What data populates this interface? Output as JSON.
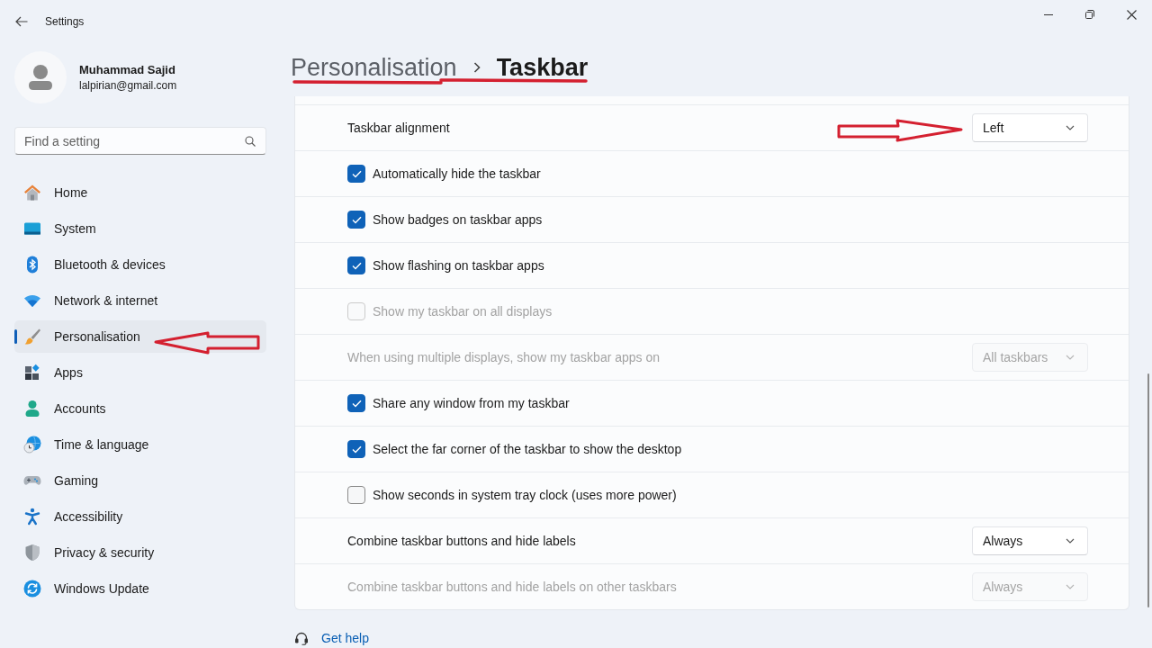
{
  "window": {
    "title": "Settings"
  },
  "user": {
    "name": "Muhammad Sajid",
    "email": "lalpirian@gmail.com"
  },
  "search": {
    "placeholder": "Find a setting"
  },
  "sidebar": {
    "items": [
      {
        "label": "Home",
        "selected": false
      },
      {
        "label": "System",
        "selected": false
      },
      {
        "label": "Bluetooth & devices",
        "selected": false
      },
      {
        "label": "Network & internet",
        "selected": false
      },
      {
        "label": "Personalisation",
        "selected": true
      },
      {
        "label": "Apps",
        "selected": false
      },
      {
        "label": "Accounts",
        "selected": false
      },
      {
        "label": "Time & language",
        "selected": false
      },
      {
        "label": "Gaming",
        "selected": false
      },
      {
        "label": "Accessibility",
        "selected": false
      },
      {
        "label": "Privacy & security",
        "selected": false
      },
      {
        "label": "Windows Update",
        "selected": false
      }
    ]
  },
  "breadcrumb": [
    "Personalisation",
    "Taskbar"
  ],
  "settings": [
    {
      "kind": "dropdown",
      "label": "Taskbar alignment",
      "value": "Left",
      "disabled": false
    },
    {
      "kind": "checkbox",
      "label": "Automatically hide the taskbar",
      "checked": true,
      "disabled": false
    },
    {
      "kind": "checkbox",
      "label": "Show badges on taskbar apps",
      "checked": true,
      "disabled": false
    },
    {
      "kind": "checkbox",
      "label": "Show flashing on taskbar apps",
      "checked": true,
      "disabled": false
    },
    {
      "kind": "checkbox",
      "label": "Show my taskbar on all displays",
      "checked": false,
      "disabled": true
    },
    {
      "kind": "dropdown",
      "label": "When using multiple displays, show my taskbar apps on",
      "value": "All taskbars",
      "disabled": true
    },
    {
      "kind": "checkbox",
      "label": "Share any window from my taskbar",
      "checked": true,
      "disabled": false
    },
    {
      "kind": "checkbox",
      "label": "Select the far corner of the taskbar to show the desktop",
      "checked": true,
      "disabled": false
    },
    {
      "kind": "checkbox",
      "label": "Show seconds in system tray clock (uses more power)",
      "checked": false,
      "disabled": false
    },
    {
      "kind": "dropdown",
      "label": "Combine taskbar buttons and hide labels",
      "value": "Always",
      "disabled": false
    },
    {
      "kind": "dropdown",
      "label": "Combine taskbar buttons and hide labels on other taskbars",
      "value": "Always",
      "disabled": true
    }
  ],
  "help_link": "Get help"
}
